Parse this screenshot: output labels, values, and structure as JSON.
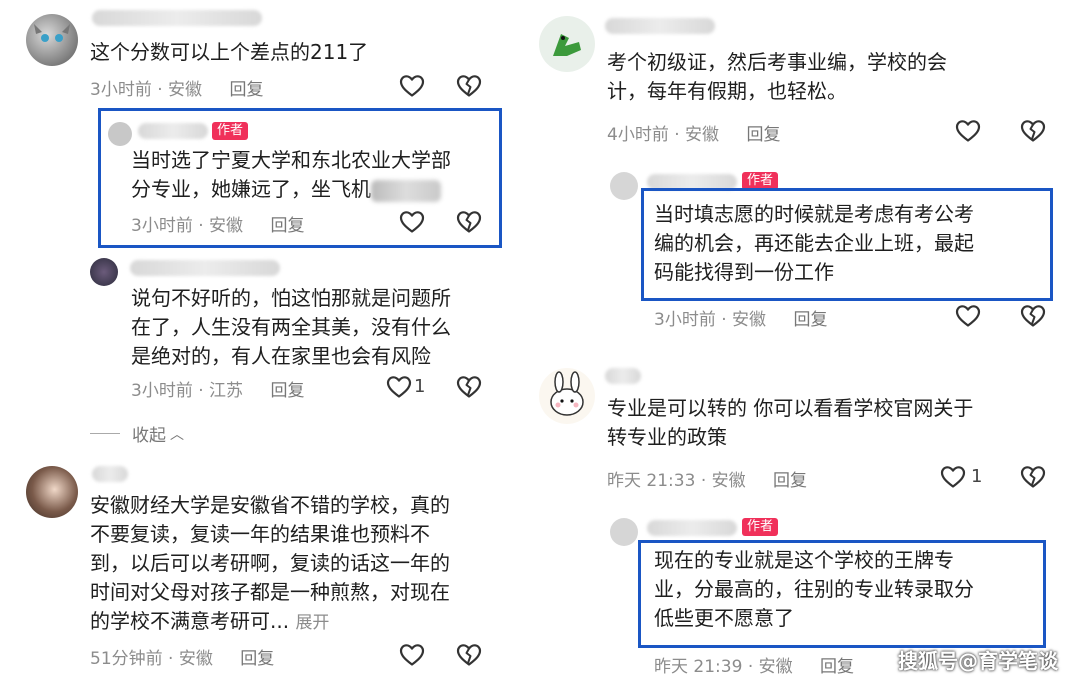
{
  "left": {
    "c1": {
      "text": "这个分数可以上个差点的211了",
      "time": "3小时前",
      "location": "安徽",
      "reply": "回复"
    },
    "c1r1": {
      "tag": "作者",
      "text": "当时选了宁夏大学和东北农业大学部\n分专业，她嫌远了，坐飞机",
      "time": "3小时前",
      "location": "安徽",
      "reply": "回复"
    },
    "c1r2": {
      "text": "说句不好听的，怕这怕那就是问题所\n在了，人生没有两全其美，没有什么\n是绝对的，有人在家里也会有风险",
      "time": "3小时前",
      "location": "江苏",
      "reply": "回复",
      "likes": "1"
    },
    "collapse": "收起",
    "c2": {
      "text": "安徽财经大学是安徽省不错的学校，真的\n不要复读，复读一年的结果谁也预料不\n到，以后可以考研啊，复读的话这一年的\n时间对父母对孩子都是一种煎熬，对现在\n的学校不满意考研可...",
      "expand": "展开",
      "time": "51分钟前",
      "location": "安徽",
      "reply": "回复"
    }
  },
  "right": {
    "c3": {
      "text": "考个初级证，然后考事业编，学校的会\n计，每年有假期，也轻松。",
      "time": "4小时前",
      "location": "安徽",
      "reply": "回复"
    },
    "c3r1": {
      "tag": "作者",
      "text": "当时填志愿的时候就是考虑有考公考\n编的机会，再还能去企业上班，最起\n码能找得到一份工作",
      "time": "3小时前",
      "location": "安徽",
      "reply": "回复"
    },
    "c4": {
      "text": "专业是可以转的 你可以看看学校官网关于\n转专业的政策",
      "time": "昨天 21:33",
      "location": "安徽",
      "reply": "回复",
      "likes": "1"
    },
    "c4r1": {
      "tag": "作者",
      "text": "现在的专业就是这个学校的王牌专\n业，分最高的，往别的专业转录取分\n低些更不愿意了",
      "time": "昨天 21:39",
      "location": "安徽",
      "reply": "回复"
    }
  },
  "sep": "·",
  "watermark": "搜狐号@育学笔谈",
  "colors": {
    "highlight": "#1a56c4",
    "author_tag": "#f0305a",
    "meta": "#8c8c8c"
  }
}
